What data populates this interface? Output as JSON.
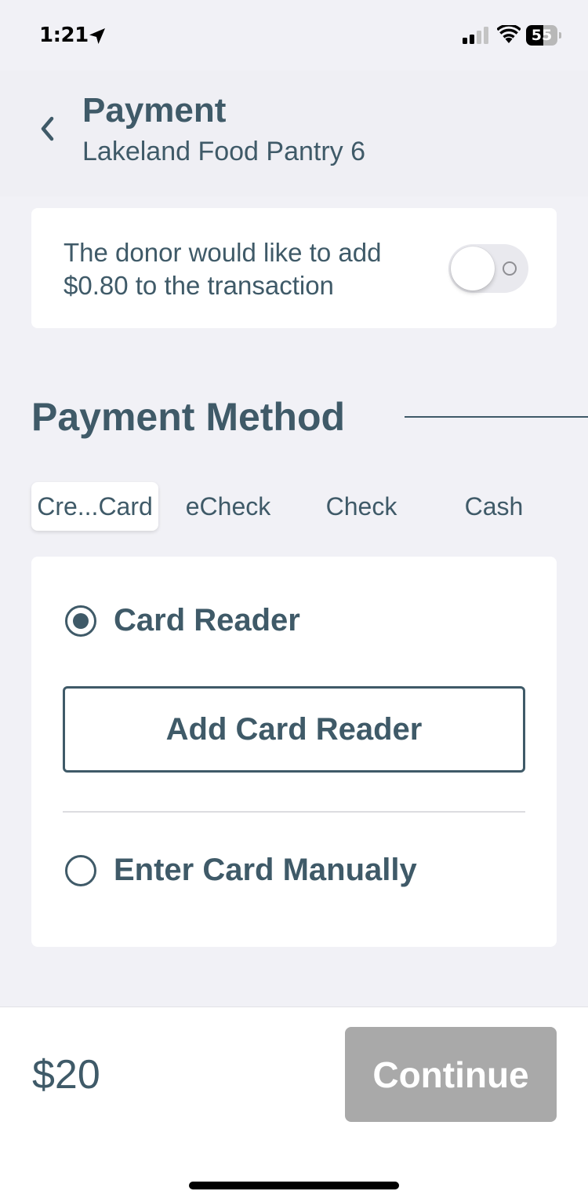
{
  "status_bar": {
    "time": "1:21",
    "battery_level": "55",
    "battery_fraction": 0.55,
    "icons": [
      "location-arrow-icon",
      "cellular-signal-icon",
      "wifi-icon",
      "battery-icon"
    ]
  },
  "header": {
    "back_icon": "chevron-left-icon",
    "title": "Payment",
    "subtitle": "Lakeland Food Pantry 6"
  },
  "donor_fee": {
    "text": "The donor would like to add $0.80 to the transaction",
    "toggle_on": false
  },
  "payment_method": {
    "title": "Payment Method",
    "tabs": [
      {
        "label": "Cre...Card",
        "active": true
      },
      {
        "label": "eCheck",
        "active": false
      },
      {
        "label": "Check",
        "active": false
      },
      {
        "label": "Cash",
        "active": false
      }
    ],
    "options": [
      {
        "label": "Card Reader",
        "selected": true
      },
      {
        "label": "Enter Card Manually",
        "selected": false
      }
    ],
    "add_reader_label": "Add Card Reader"
  },
  "footer": {
    "amount": "$20",
    "continue_label": "Continue",
    "continue_disabled": true
  },
  "colors": {
    "primary": "#3f5a68",
    "background": "#f1f1f6",
    "card": "#ffffff",
    "disabled_button": "#a9a9a9"
  }
}
